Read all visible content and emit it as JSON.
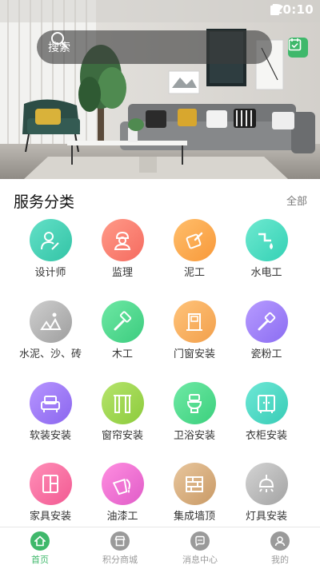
{
  "status_bar": {
    "time": "10:10"
  },
  "search": {
    "placeholder": "搜索",
    "icon": "search-icon"
  },
  "checkin": {
    "icon": "calendar-check-icon"
  },
  "section": {
    "title": "服务分类",
    "more": "全部"
  },
  "services": [
    {
      "label": "设计师",
      "icon": "designer-icon",
      "color_from": "#63e0c7",
      "color_to": "#33c4a6"
    },
    {
      "label": "监理",
      "icon": "supervisor-icon",
      "color_from": "#ff9a88",
      "color_to": "#f56b60"
    },
    {
      "label": "泥工",
      "icon": "trowel-icon",
      "color_from": "#ffbe6b",
      "color_to": "#f8993a"
    },
    {
      "label": "水电工",
      "icon": "plumbing-icon",
      "color_from": "#6ee9d0",
      "color_to": "#34d1b5"
    },
    {
      "label": "水泥、沙、砖",
      "icon": "cement-icon",
      "color_from": "#cfcfcf",
      "color_to": "#9e9e9e"
    },
    {
      "label": "木工",
      "icon": "hammer-icon",
      "color_from": "#6ee8a4",
      "color_to": "#3ccc7f"
    },
    {
      "label": "门窗安装",
      "icon": "door-icon",
      "color_from": "#ffc37a",
      "color_to": "#f2a04c"
    },
    {
      "label": "瓷粉工",
      "icon": "scraper-icon",
      "color_from": "#b79bff",
      "color_to": "#8b6df2"
    },
    {
      "label": "软装安装",
      "icon": "sofa-icon",
      "color_from": "#b795ff",
      "color_to": "#8a66ef"
    },
    {
      "label": "窗帘安装",
      "icon": "curtain-icon",
      "color_from": "#b6e46c",
      "color_to": "#8ccb3c"
    },
    {
      "label": "卫浴安装",
      "icon": "toilet-icon",
      "color_from": "#6fe9a5",
      "color_to": "#3bd07d"
    },
    {
      "label": "衣柜安装",
      "icon": "wardrobe-icon",
      "color_from": "#6ee8d6",
      "color_to": "#38ccb6"
    },
    {
      "label": "家具安装",
      "icon": "cabinet-icon",
      "color_from": "#ff8fb8",
      "color_to": "#f25a92"
    },
    {
      "label": "油漆工",
      "icon": "paint-bucket-icon",
      "color_from": "#ff8ee0",
      "color_to": "#e05cc8"
    },
    {
      "label": "集成墙顶",
      "icon": "wall-bricks-icon",
      "color_from": "#e8c69d",
      "color_to": "#c99a66"
    },
    {
      "label": "灯具安装",
      "icon": "lamp-icon",
      "color_from": "#d4d4d4",
      "color_to": "#a3a3a3"
    }
  ],
  "nav": [
    {
      "label": "首页",
      "icon": "home-icon",
      "active": true
    },
    {
      "label": "积分商城",
      "icon": "store-icon",
      "active": false
    },
    {
      "label": "消息中心",
      "icon": "message-icon",
      "active": false
    },
    {
      "label": "我的",
      "icon": "user-icon",
      "active": false
    }
  ],
  "colors": {
    "accent": "#3fb86b",
    "inactive": "#9a9a9a"
  }
}
